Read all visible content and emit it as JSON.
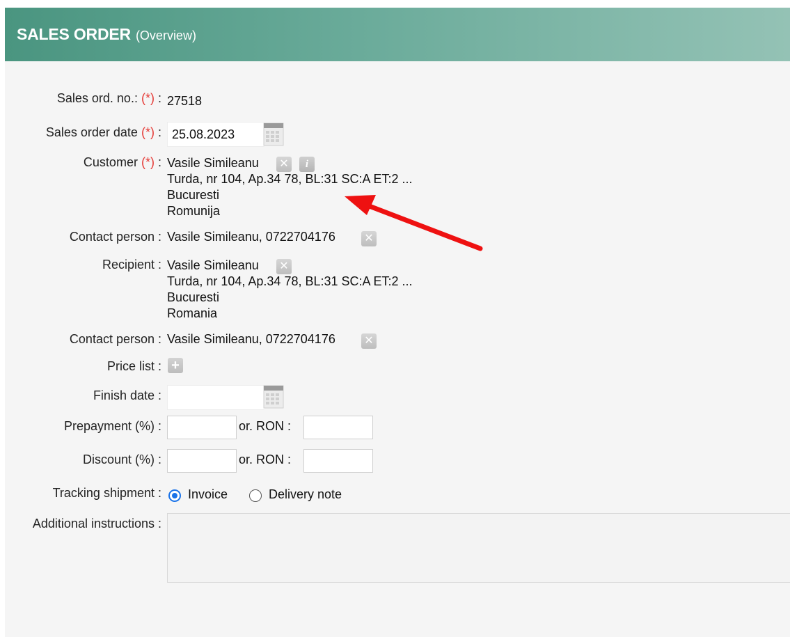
{
  "header": {
    "title": "SALES ORDER",
    "subtitle": "(Overview)"
  },
  "required_mark": "(*)",
  "form": {
    "sales_order_no": {
      "label": "Sales ord. no.:",
      "suffix": ":",
      "value": "27518"
    },
    "sales_order_date": {
      "label": "Sales order date",
      "suffix": ":",
      "value": "25.08.2023"
    },
    "customer": {
      "label": "Customer",
      "suffix": ":",
      "name": "Vasile Simileanu",
      "address": "Turda, nr 104, Ap.34 78, BL:31 SC:A ET:2 ...",
      "city": "Bucuresti",
      "country": "Romunija"
    },
    "contact_person_1": {
      "label": "Contact person :",
      "value": "Vasile Simileanu, 0722704176"
    },
    "recipient": {
      "label": "Recipient :",
      "name": "Vasile Simileanu",
      "address": "Turda, nr 104, Ap.34 78, BL:31 SC:A ET:2 ...",
      "city": "Bucuresti",
      "country": "Romania"
    },
    "contact_person_2": {
      "label": "Contact person :",
      "value": "Vasile Simileanu, 0722704176"
    },
    "price_list": {
      "label": "Price list :"
    },
    "finish_date": {
      "label": "Finish date :",
      "value": ""
    },
    "prepayment": {
      "label": "Prepayment (%) :",
      "or_label": "or. RON :",
      "percent": "",
      "ron": ""
    },
    "discount": {
      "label": "Discount (%) :",
      "or_label": "or. RON :",
      "percent": "",
      "ron": ""
    },
    "tracking_shipment": {
      "label": "Tracking shipment :",
      "options": [
        {
          "label": "Invoice",
          "selected": true
        },
        {
          "label": "Delivery note",
          "selected": false
        }
      ]
    },
    "additional_instructions": {
      "label": "Additional instructions :",
      "value": ""
    }
  },
  "icons": {
    "calendar": "calendar-icon",
    "clear": "clear-x-icon",
    "info": "info-icon",
    "add": "plus-icon",
    "annotation": "red-arrow"
  },
  "colors": {
    "header_start": "#4a9580",
    "header_end": "#94c2b5",
    "required": "#e53935",
    "radio_selected": "#1a73e8",
    "annotation_arrow": "#ee1111"
  }
}
